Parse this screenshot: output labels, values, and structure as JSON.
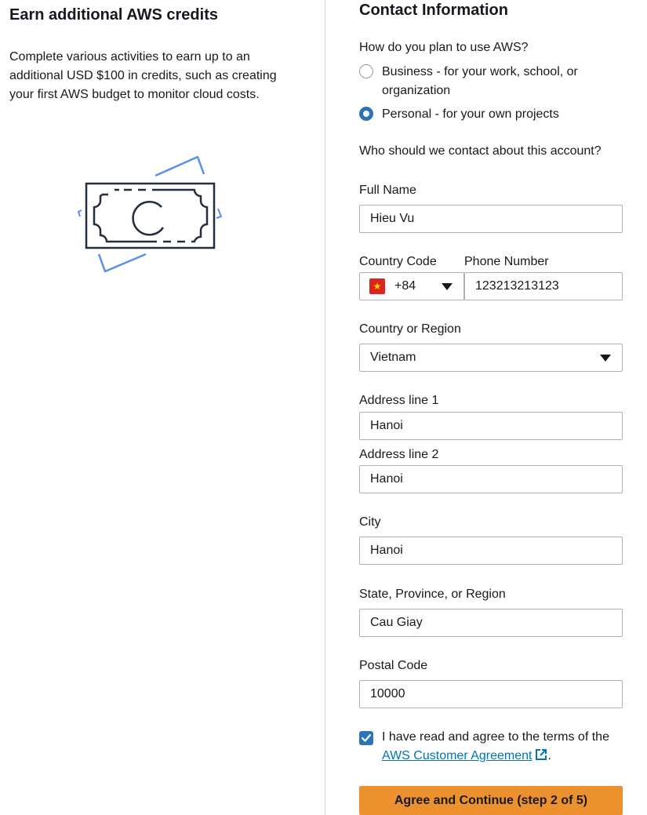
{
  "credits_panel": {
    "title": "Earn additional AWS credits",
    "description": "Complete various activities to earn up to an additional USD $100 in credits, such as creating your first AWS budget to monitor cloud costs.",
    "illustration_icon": "money-bill-icon"
  },
  "contact": {
    "title": "Contact Information",
    "usage_question": "How do you plan to use AWS?",
    "usage_options": [
      {
        "label": "Business - for your work, school, or organization",
        "selected": false
      },
      {
        "label": "Personal - for your own projects",
        "selected": true
      }
    ],
    "contact_question": "Who should we contact about this account?",
    "full_name": {
      "label": "Full Name",
      "value": "Hieu Vu"
    },
    "country_code": {
      "label": "Country Code",
      "value": "+84"
    },
    "phone": {
      "label": "Phone Number",
      "value": "123213213123"
    },
    "country": {
      "label": "Country or Region",
      "value": "Vietnam"
    },
    "address1": {
      "label": "Address line 1",
      "value": "Hanoi"
    },
    "address2": {
      "label": "Address line 2",
      "value": "Hanoi"
    },
    "city": {
      "label": "City",
      "value": "Hanoi"
    },
    "state": {
      "label": "State, Province, or Region",
      "value": "Cau Giay"
    },
    "postal": {
      "label": "Postal Code",
      "value": "10000"
    },
    "agreement": {
      "checked": true,
      "text_before": "I have read and agree to the terms of the ",
      "link_text": "AWS Customer Agreement",
      "text_after": "."
    },
    "submit_label": "Agree and Continue (step 2 of 5)"
  },
  "colors": {
    "accent_blue": "#2e73b8",
    "link_blue": "#0073bb",
    "button_orange": "#ec912d",
    "flag_red": "#da251d",
    "flag_star": "#ffcd00"
  }
}
